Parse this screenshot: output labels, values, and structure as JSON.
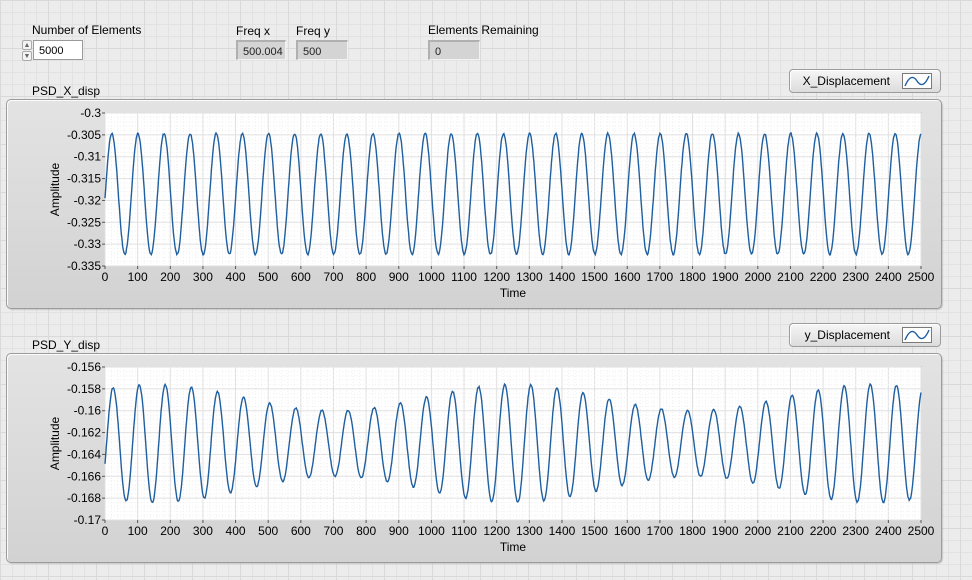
{
  "controls": {
    "number_of_elements": {
      "label": "Number of Elements",
      "value": "5000"
    },
    "freq_x": {
      "label": "Freq x",
      "value": "500.004"
    },
    "freq_y": {
      "label": "Freq y",
      "value": "500"
    },
    "elements_remaining": {
      "label": "Elements Remaining",
      "value": "0"
    }
  },
  "colors": {
    "plot_line": "#1f5f9f",
    "plot_bg": "#ffffff",
    "grid": "#e0e0e0"
  },
  "chart_data": [
    {
      "type": "line",
      "title": "PSD_X_disp",
      "xlabel": "Time",
      "ylabel": "Amplitude",
      "legend": "top-right",
      "grid": true,
      "xlim": [
        0,
        2500
      ],
      "ylim": [
        -0.335,
        -0.3
      ],
      "xticks": [
        "0",
        "100",
        "200",
        "300",
        "400",
        "500",
        "600",
        "700",
        "800",
        "900",
        "1000",
        "1100",
        "1200",
        "1300",
        "1400",
        "1500",
        "1600",
        "1700",
        "1800",
        "1900",
        "2000",
        "2100",
        "2200",
        "2300",
        "2400",
        "2500"
      ],
      "yticks": [
        "-0.3",
        "-0.305",
        "-0.31",
        "-0.315",
        "-0.32",
        "-0.325",
        "-0.33",
        "-0.335"
      ],
      "series": [
        {
          "name": "X_Displacement",
          "period": 80,
          "center": -0.3185,
          "amplitude": 0.0138,
          "phase_start": 1.5,
          "noise": 0.0004
        }
      ]
    },
    {
      "type": "line",
      "title": "PSD_Y_disp",
      "xlabel": "Time",
      "ylabel": "Amplitude",
      "legend": "top-right",
      "grid": true,
      "xlim": [
        0,
        2500
      ],
      "ylim": [
        -0.17,
        -0.156
      ],
      "xticks": [
        "0",
        "100",
        "200",
        "300",
        "400",
        "500",
        "600",
        "700",
        "800",
        "900",
        "1000",
        "1100",
        "1200",
        "1300",
        "1400",
        "1500",
        "1600",
        "1700",
        "1800",
        "1900",
        "2000",
        "2100",
        "2200",
        "2300",
        "2400",
        "2500"
      ],
      "yticks": [
        "-0.156",
        "-0.158",
        "-0.16",
        "-0.162",
        "-0.164",
        "-0.166",
        "-0.168",
        "-0.17"
      ],
      "series": [
        {
          "name": "y_Displacement",
          "period": 80,
          "center": -0.163,
          "amplitude": 0.0042,
          "amplitude_variation": 0.0012,
          "phase_start": 1.2,
          "noise": 0.00012
        }
      ]
    }
  ]
}
